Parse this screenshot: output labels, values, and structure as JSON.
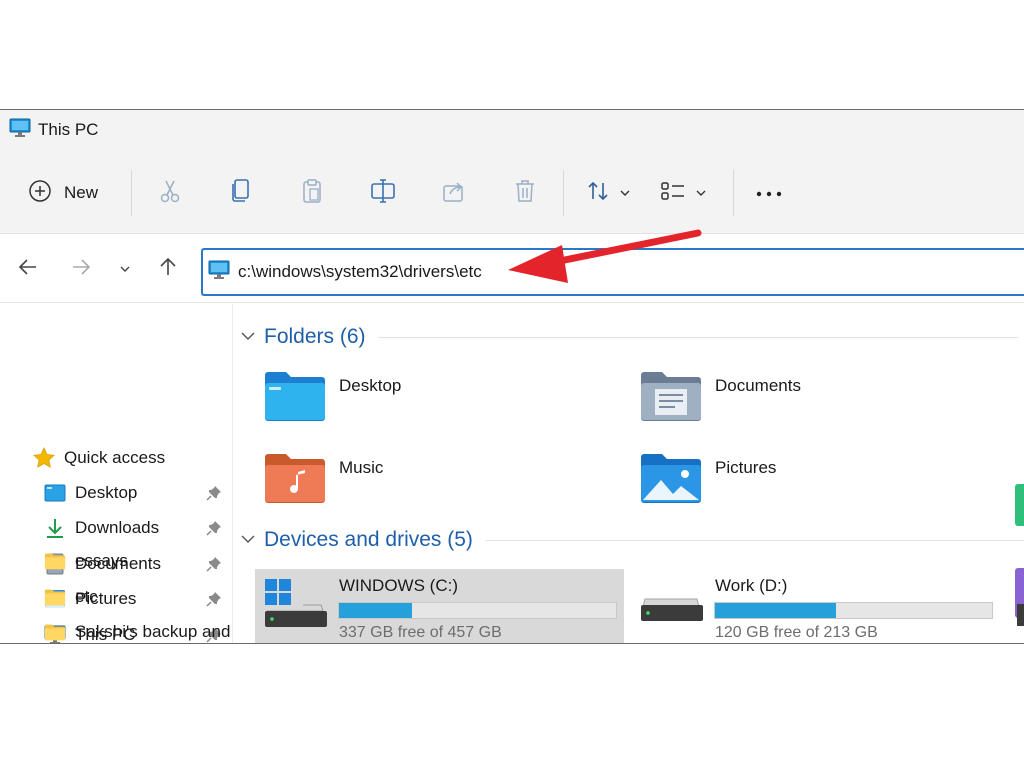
{
  "window": {
    "title": "This PC"
  },
  "toolbar": {
    "new_label": "New"
  },
  "address": {
    "value": "c:\\windows\\system32\\drivers\\etc"
  },
  "sidebar": {
    "items": [
      {
        "label": "Quick access",
        "icon": "star-icon"
      },
      {
        "label": "Desktop",
        "icon": "desktop-icon",
        "pinned": true
      },
      {
        "label": "Downloads",
        "icon": "download-icon",
        "pinned": true
      },
      {
        "label": "Documents",
        "icon": "documents-icon",
        "pinned": true
      },
      {
        "label": "Pictures",
        "icon": "pictures-icon",
        "pinned": true
      },
      {
        "label": "This PC",
        "icon": "monitor-icon",
        "pinned": true
      },
      {
        "label": "essays",
        "icon": "folder-icon"
      },
      {
        "label": "etc",
        "icon": "folder-icon"
      },
      {
        "label": "Sakshi's backup and",
        "icon": "folder-icon"
      }
    ]
  },
  "folders": {
    "header": "Folders (6)",
    "items": [
      {
        "name": "Desktop",
        "icon": "desktop-folder-icon"
      },
      {
        "name": "Documents",
        "icon": "documents-folder-icon"
      },
      {
        "name": "Music",
        "icon": "music-folder-icon"
      },
      {
        "name": "Pictures",
        "icon": "pictures-folder-icon"
      }
    ]
  },
  "drives": {
    "header": "Devices and drives (5)",
    "items": [
      {
        "name": "WINDOWS (C:)",
        "free_text": "337 GB free of 457 GB",
        "used_fraction": 0.263,
        "selected": true
      },
      {
        "name": "Work (D:)",
        "free_text": "120 GB free of 213 GB",
        "used_fraction": 0.437,
        "selected": false
      }
    ]
  },
  "colors": {
    "accent": "#2a78c8",
    "header_text": "#1f5fa9",
    "drive_fill": "#26a0da",
    "annotation_arrow": "#e3242b"
  }
}
